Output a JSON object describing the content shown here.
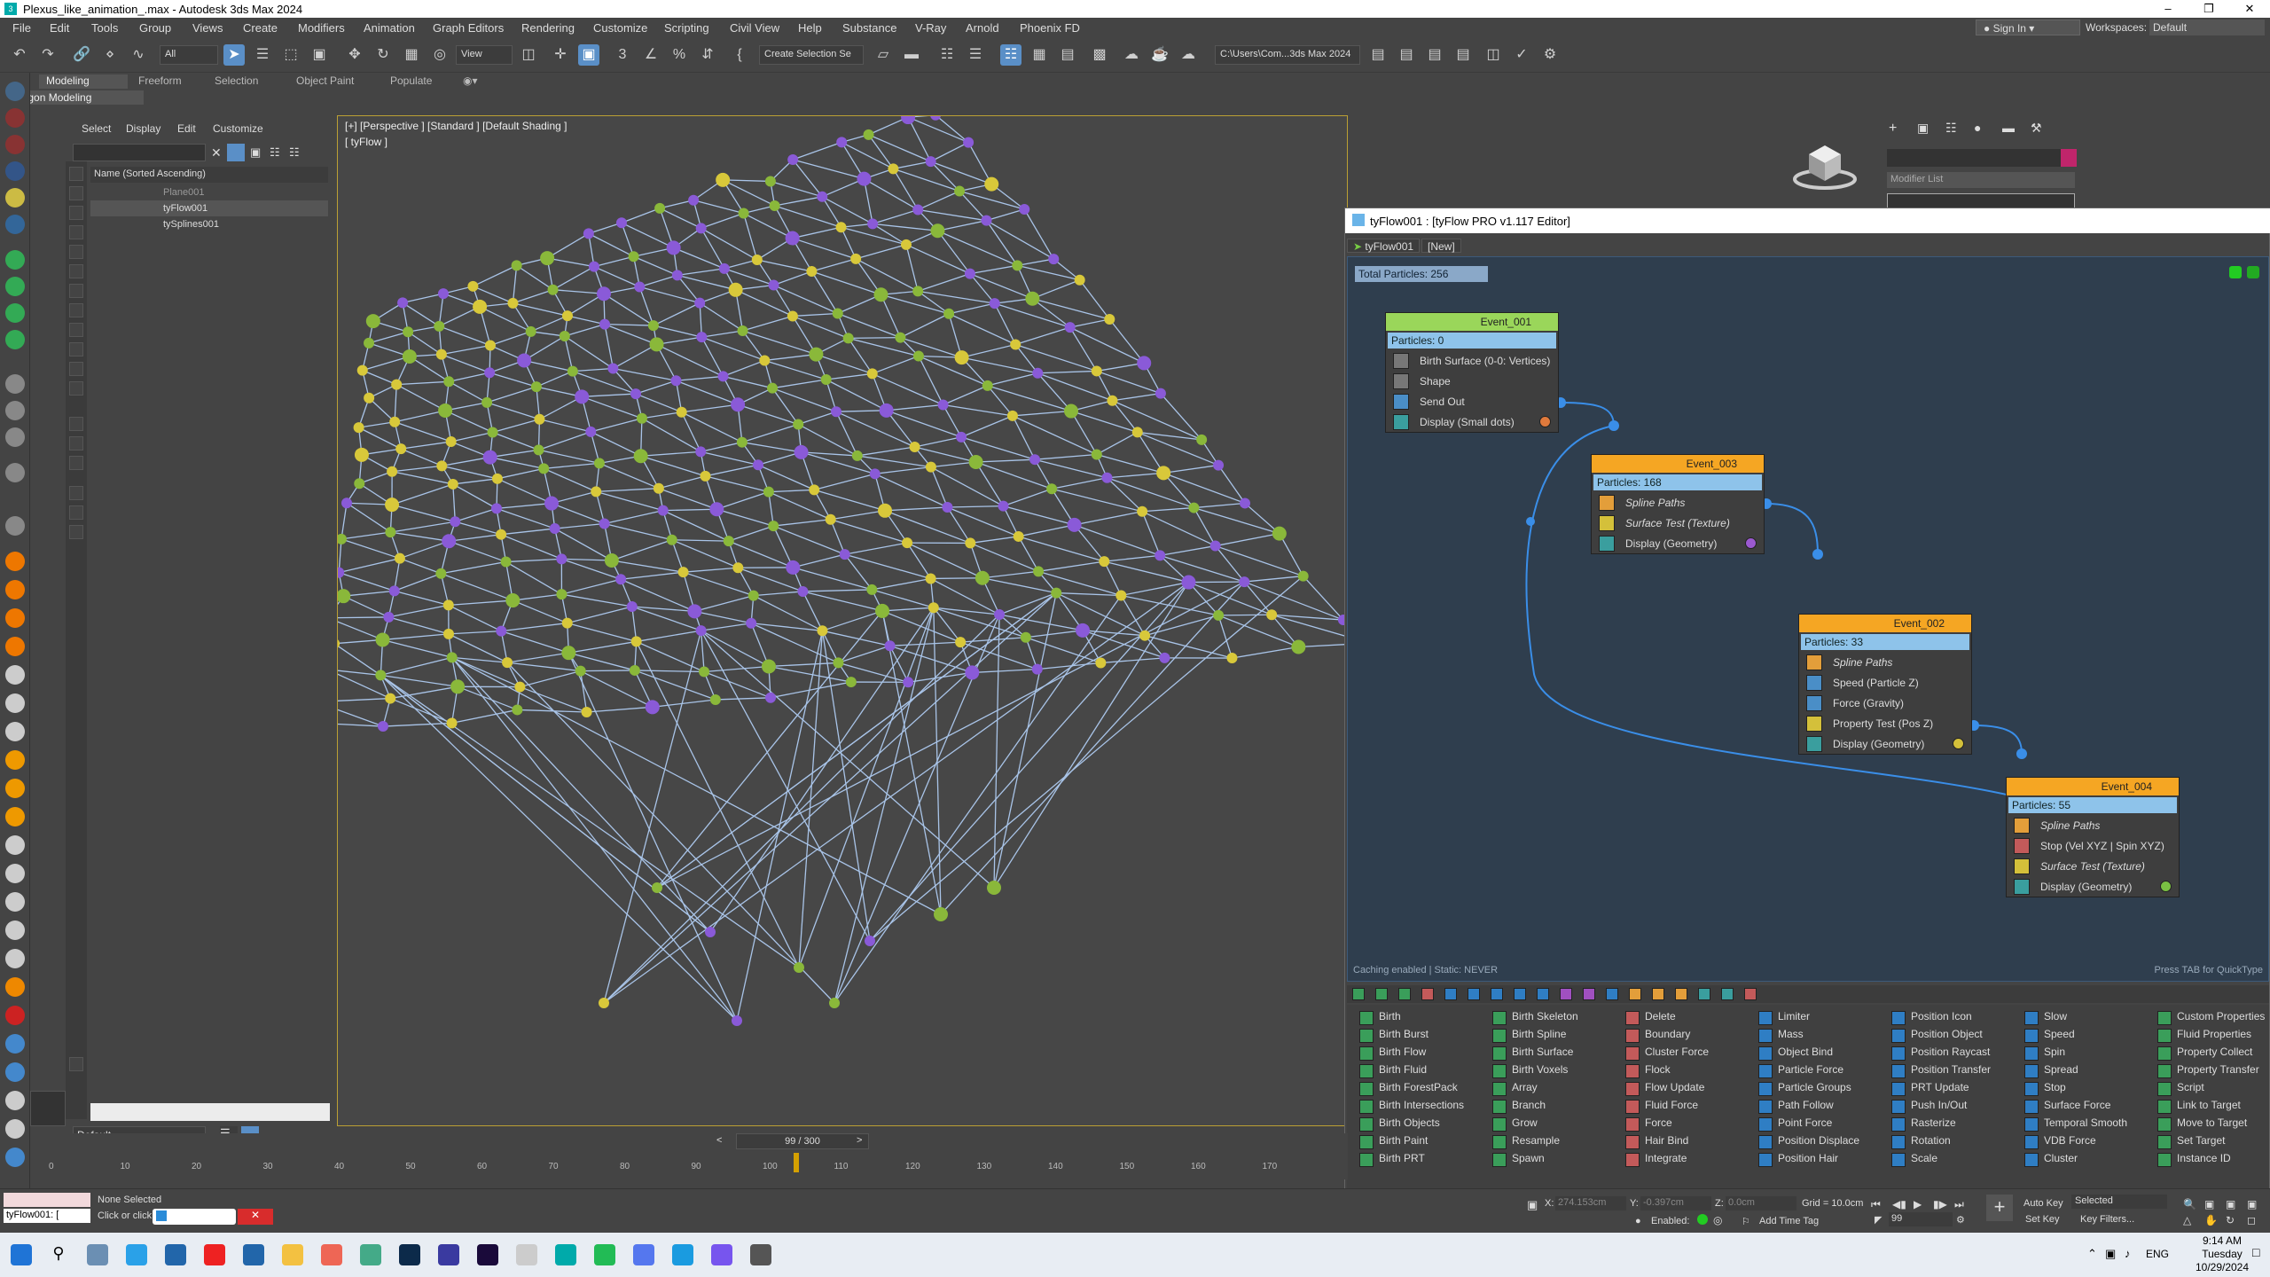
{
  "window": {
    "title": "Plexus_like_animation_.max - Autodesk 3ds Max 2024"
  },
  "menu": [
    "File",
    "Edit",
    "Tools",
    "Group",
    "Views",
    "Create",
    "Modifiers",
    "Animation",
    "Graph Editors",
    "Rendering",
    "Customize",
    "Scripting",
    "Civil View",
    "Help",
    "Substance",
    "V-Ray",
    "Arnold",
    "Phoenix FD"
  ],
  "account": {
    "sign_in": "Sign In",
    "workspaces_label": "Workspaces:",
    "workspace": "Default"
  },
  "toolbar": {
    "filter": "All",
    "view": "View",
    "selection_set": "Create Selection Se",
    "path": "C:\\Users\\Com...3ds Max 2024"
  },
  "ribbon": {
    "tabs": [
      "Modeling",
      "Freeform",
      "Selection",
      "Object Paint",
      "Populate"
    ],
    "sub": "Polygon Modeling"
  },
  "explorer": {
    "tabs": [
      "Select",
      "Display",
      "Edit",
      "Customize"
    ],
    "header": "Name (Sorted Ascending)",
    "rows": [
      {
        "name": "Plane001"
      },
      {
        "name": "tyFlow001"
      },
      {
        "name": "tySplines001"
      }
    ]
  },
  "layer": {
    "name": "Default"
  },
  "viewport": {
    "label": "[+] [Perspective ] [Standard ] [Default Shading ]",
    "name": "[ tyFlow ]"
  },
  "command_panel": {
    "modifier_list": "Modifier List"
  },
  "editor": {
    "title": "tyFlow001 : [tyFlow PRO v1.117 Editor]",
    "tabs": [
      "tyFlow001",
      "[New]"
    ],
    "total": "Total Particles: 256",
    "events": [
      {
        "name": "Event_001",
        "particles": "Particles: 0",
        "ops": [
          "Birth Surface (0-0: Vertices)",
          "Shape",
          "Send Out",
          "Display (Small dots)"
        ],
        "color": "#9ad65a",
        "dot": "#e07a3c"
      },
      {
        "name": "Event_003",
        "particles": "Particles: 168",
        "ops": [
          "Spline Paths",
          "Surface Test (Texture)",
          "Display (Geometry)"
        ],
        "color": "#f5a623",
        "dot": "#9b59d0"
      },
      {
        "name": "Event_002",
        "particles": "Particles: 33",
        "ops": [
          "Spline Paths",
          "Speed (Particle Z)",
          "Force (Gravity)",
          "Property Test (Pos Z)",
          "Display (Geometry)"
        ],
        "color": "#f5a623",
        "dot": "#d4c03a"
      },
      {
        "name": "Event_004",
        "particles": "Particles: 55",
        "ops": [
          "Spline Paths",
          "Stop (Vel XYZ | Spin XYZ)",
          "Surface Test (Texture)",
          "Display (Geometry)"
        ],
        "color": "#f5a623",
        "dot": "#7ac043"
      }
    ],
    "status": "Caching enabled | Static: NEVER",
    "hint": "Press TAB for QuickType",
    "operators": [
      [
        "Birth",
        "Birth Burst",
        "Birth Flow",
        "Birth Fluid",
        "Birth ForestPack",
        "Birth Intersections",
        "Birth Objects",
        "Birth Paint",
        "Birth PRT"
      ],
      [
        "Birth Skeleton",
        "Birth Spline",
        "Birth Surface",
        "Birth Voxels",
        "Array",
        "Branch",
        "Grow",
        "Resample",
        "Spawn"
      ],
      [
        "Delete",
        "Boundary",
        "Cluster Force",
        "Flock",
        "Flow Update",
        "Fluid Force",
        "Force",
        "Hair Bind",
        "Integrate"
      ],
      [
        "Limiter",
        "Mass",
        "Object Bind",
        "Particle Force",
        "Particle Groups",
        "Path Follow",
        "Point Force",
        "Position Displace",
        "Position Hair"
      ],
      [
        "Position Icon",
        "Position Object",
        "Position Raycast",
        "Position Transfer",
        "PRT Update",
        "Push In/Out",
        "Rasterize",
        "Rotation",
        "Scale"
      ],
      [
        "Slow",
        "Speed",
        "Spin",
        "Spread",
        "Stop",
        "Surface Force",
        "Temporal Smooth",
        "VDB Force",
        "Cluster"
      ],
      [
        "Custom Properties",
        "Fluid Properties",
        "Property Collect",
        "Property Transfer",
        "Script",
        "Link to Target",
        "Move to Target",
        "Set Target",
        "Instance ID"
      ]
    ]
  },
  "timeline": {
    "frame": "99 / 300",
    "ticks": [
      "0",
      "10",
      "20",
      "30",
      "40",
      "50",
      "60",
      "70",
      "80",
      "90",
      "100",
      "110",
      "120",
      "130",
      "140",
      "150",
      "160",
      "170"
    ]
  },
  "status": {
    "selected": "None Selected",
    "hint": "Click or click",
    "script": "tyFlow001: [",
    "x_label": "X:",
    "x": "274.153cm",
    "y_label": "Y:",
    "y": "-0.397cm",
    "z_label": "Z:",
    "z": "0.0cm",
    "grid": "Grid = 10.0cm",
    "enabled": "Enabled:",
    "add_tag": "Add Time Tag",
    "autokey": "Auto Key",
    "setkey": "Set Key",
    "selected_dd": "Selected",
    "keyfilters": "Key Filters...",
    "frame": "99"
  },
  "taskbar": {
    "time": "9:14 AM",
    "day": "Tuesday",
    "date": "10/29/2024",
    "lang": "ENG"
  }
}
